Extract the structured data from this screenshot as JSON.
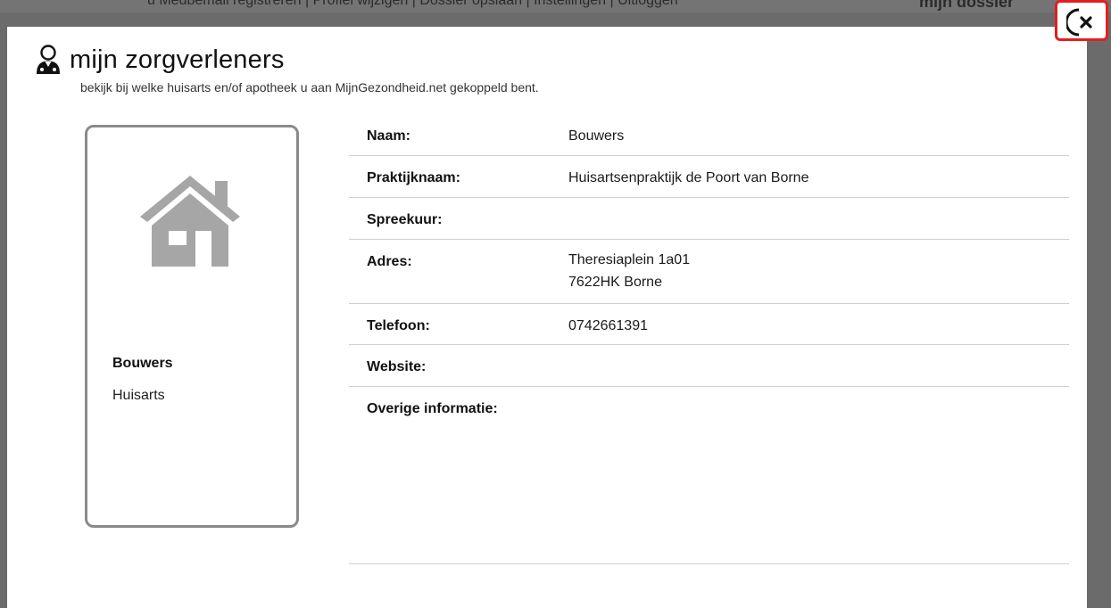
{
  "background": {
    "top_nav_text": "u Medbemail registreren | Profiel wijzigen | Dossier opslaan | Instellingen | Uitloggen",
    "top_right_text": "mijn dossier"
  },
  "header": {
    "icon": "doctor-icon",
    "title": "mijn zorgverleners",
    "subtitle": "bekijk bij welke huisarts en/of apotheek u aan MijnGezondheid.net gekoppeld bent."
  },
  "card": {
    "icon": "house-icon",
    "name": "Bouwers",
    "type": "Huisarts"
  },
  "details": [
    {
      "label": "Naam:",
      "value": "Bouwers"
    },
    {
      "label": "Praktijknaam:",
      "value": "Huisartsenpraktijk de Poort van Borne"
    },
    {
      "label": "Spreekuur:",
      "value": ""
    },
    {
      "label": "Adres:",
      "value_line1": "Theresiaplein 1a01",
      "value_line2": "7622HK Borne"
    },
    {
      "label": "Telefoon:",
      "value": "0742661391"
    },
    {
      "label": "Website:",
      "value": ""
    },
    {
      "label": "Overige informatie:",
      "value": ""
    }
  ],
  "close": {
    "icon": "close-icon"
  },
  "colors": {
    "highlight": "#e41e1e",
    "icon_gray": "#a6a6a6",
    "overlay": "#6b6b6b"
  }
}
